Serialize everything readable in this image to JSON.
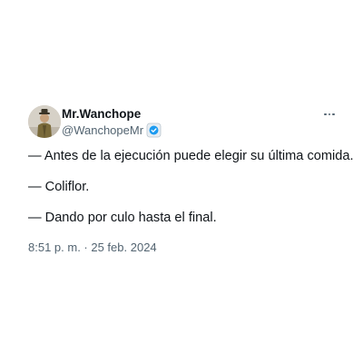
{
  "author": {
    "display_name": "Mr.Wanchope",
    "handle": "@WanchopeMr",
    "avatar_icon": "profile-avatar",
    "badge_icon": "affiliate-badge-icon"
  },
  "menu": {
    "icon": "more-options-icon"
  },
  "tweet": {
    "lines": [
      "— Antes de la ejecución puede elegir su última comida.",
      "— Coliflor.",
      "— Dando por culo hasta el final."
    ],
    "timestamp": "8:51 p. m. · 25 feb. 2024"
  },
  "colors": {
    "text_primary": "#0f1419",
    "text_secondary": "#536471",
    "background": "#ffffff"
  }
}
